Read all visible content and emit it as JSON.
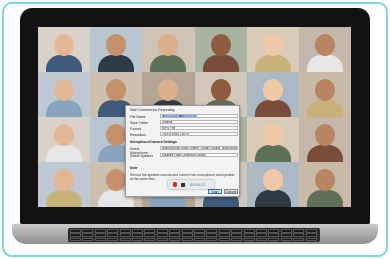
{
  "dialog": {
    "title": "Start Conference Recording",
    "fields": [
      {
        "label": "File Name",
        "value": "Conference_Recording",
        "selected": true
      },
      {
        "label": "Save Folder",
        "value": "Videos",
        "selected": false
      },
      {
        "label": "Format",
        "value": "MP4 File",
        "selected": false
      },
      {
        "label": "Resolution",
        "value": "1920×1080 (16:9)",
        "selected": false
      }
    ],
    "section_label": "Microphone/Camera Settings",
    "device_fields": [
      {
        "label": "Select Microphone",
        "value": "Microphone Array (Intel® Smart Sound Technology)",
        "selected": false
      },
      {
        "label": "Select Speaker",
        "value": "Realtek High Definition Audio",
        "selected": false
      }
    ],
    "note_label": "Note",
    "note_text": "Record the speaker sounds and voices from microphone and speaker at the same time.",
    "ok_label": "Start",
    "cancel_label": "Cancel"
  },
  "recording_bar": {
    "timer": "00:00:27",
    "record_icon": "record-icon",
    "stop_icon": "stop-icon"
  },
  "colors": {
    "accent": "#2f6fd1",
    "record": "#d52727",
    "frame": "#7fd6e6"
  }
}
